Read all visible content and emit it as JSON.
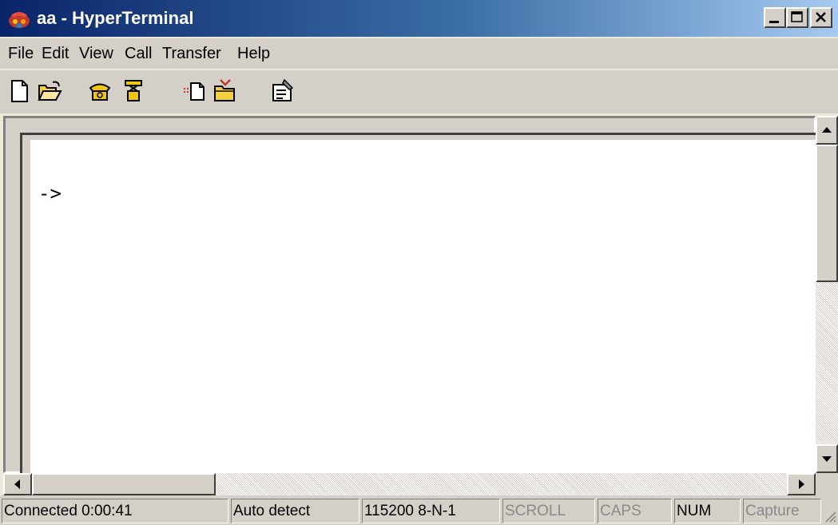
{
  "window": {
    "title": "aa - HyperTerminal",
    "caption_buttons": {
      "minimize": "minimize-icon",
      "maximize": "maximize-icon",
      "close": "close-icon"
    }
  },
  "menu": {
    "items": [
      "File",
      "Edit",
      "View",
      "Call",
      "Transfer",
      "Help"
    ]
  },
  "toolbar": {
    "buttons": [
      {
        "icon": "new-connection-icon"
      },
      {
        "icon": "open-folder-icon"
      },
      {
        "icon": "call-phone-icon"
      },
      {
        "icon": "disconnect-phone-icon"
      },
      {
        "icon": "send-file-icon"
      },
      {
        "icon": "receive-file-icon"
      },
      {
        "icon": "properties-icon"
      }
    ]
  },
  "terminal": {
    "prompt": "->"
  },
  "status_bar": {
    "connected": "Connected 0:00:41",
    "detect": "Auto detect",
    "port_settings": "115200 8-N-1",
    "scroll": "SCROLL",
    "caps": "CAPS",
    "num": "NUM",
    "capture": "Capture"
  },
  "colors": {
    "titlebar_start": "#0a246a",
    "titlebar_end": "#a6caf0",
    "face": "#d4d0c8",
    "terminal_bg": "#ffffff"
  }
}
